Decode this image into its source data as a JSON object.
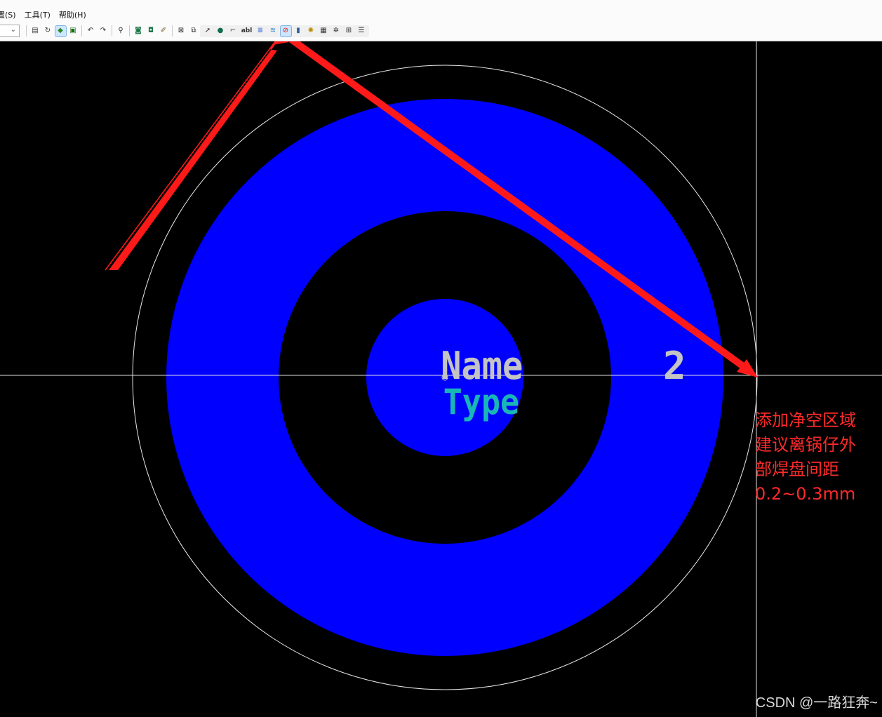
{
  "menubar": {
    "items": [
      "置(S)",
      "工具(T)",
      "帮助(H)"
    ]
  },
  "toolbar": {
    "text_tool_label": "abl",
    "buttons": [
      "properties-icon",
      "refresh-icon",
      "route-icon",
      "board-icon",
      "undo-icon",
      "redo-icon",
      "zoom-icon",
      "pad-icon",
      "via-icon",
      "brush-icon",
      "drc-icon",
      "copy-icon",
      "select-icon",
      "drill-icon",
      "pin-icon",
      "text-icon",
      "layer-icon",
      "layer2-icon",
      "keepout-icon",
      "gauge-icon",
      "sun-icon",
      "stats-icon",
      "star-icon",
      "grid-icon",
      "list-icon"
    ],
    "active_button": "keepout-icon"
  },
  "canvas": {
    "pad_name": "Name",
    "pad_type": "Type",
    "pin_number": "2",
    "colors": {
      "background": "#000000",
      "copper": "#0000ff",
      "keepout_outline": "#ffffff",
      "name_text": "#c4c4c4",
      "type_text": "#19b6b6",
      "arrow": "#ff1a1a"
    }
  },
  "annotation": {
    "lines": [
      "添加净空区域",
      "建议离锅仔外",
      "部焊盘间距",
      "0.2~0.3mm"
    ]
  },
  "watermark": "CSDN @一路狂奔~"
}
